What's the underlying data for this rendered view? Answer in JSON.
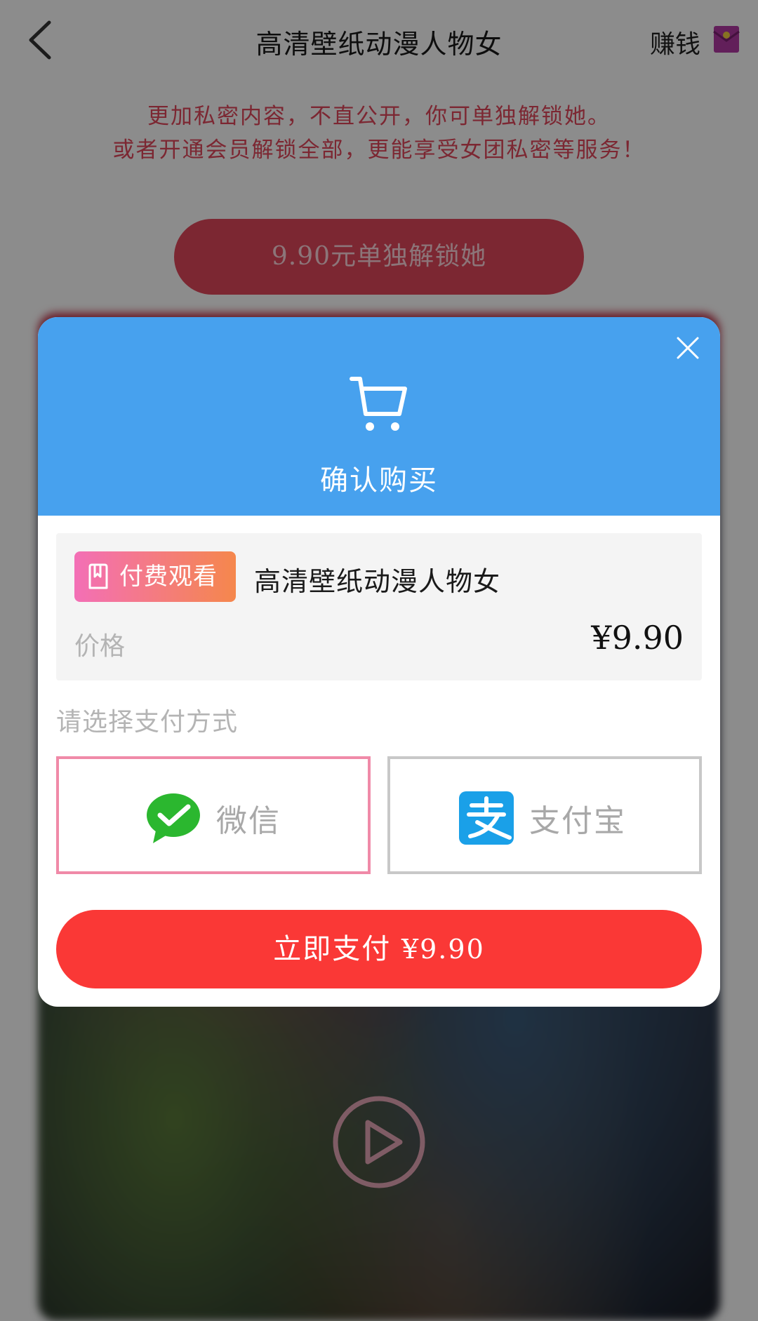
{
  "nav": {
    "title": "高清壁纸动漫人物女",
    "earn_label": "赚钱"
  },
  "intro": {
    "line1": "更加私密内容，不直公开，你可单独解锁她。",
    "line2": "或者开通会员解锁全部，更能享受女团私密等服务！"
  },
  "unlock_button": "9.90元单独解锁她",
  "dialog": {
    "title": "确认购买",
    "tag": "付费观看",
    "item_title": "高清壁纸动漫人物女",
    "price_label": "价格",
    "price_value": "¥9.90",
    "payment_prompt": "请选择支付方式",
    "payment_methods": [
      {
        "name": "微信",
        "icon": "wechat-icon",
        "selected": true
      },
      {
        "name": "支付宝",
        "icon": "alipay-icon",
        "selected": false
      }
    ],
    "pay_now_label": "立即支付",
    "pay_now_amount": "¥9.90"
  },
  "colors": {
    "header_blue": "#47a1ee",
    "pay_red": "#fa3836",
    "accent_pink": "#e2485c",
    "selected_border": "#f08aa8"
  }
}
